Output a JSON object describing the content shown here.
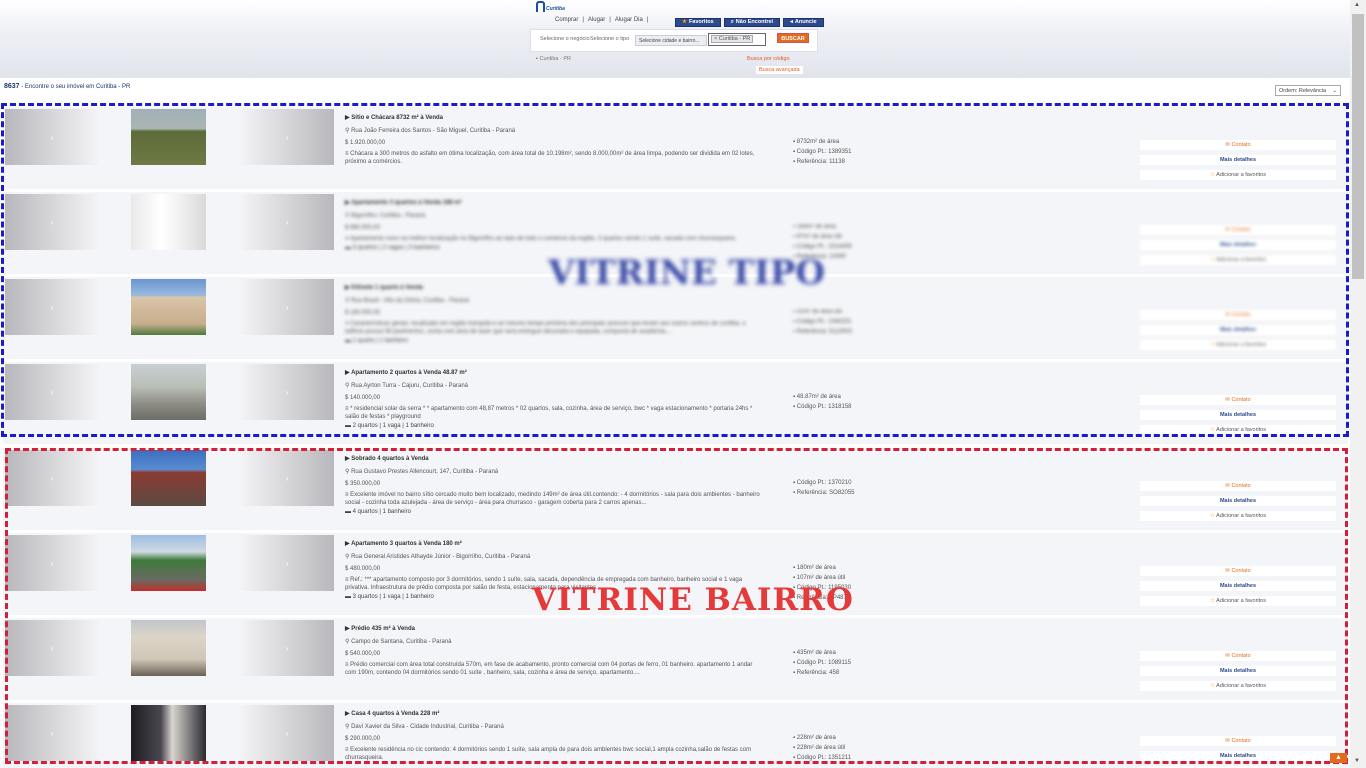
{
  "header": {
    "logo_text": "Curitiba",
    "nav": [
      "Comprar",
      "|",
      "Alugar",
      "|",
      "Alugar Dia",
      "|"
    ],
    "buttons": [
      {
        "label": "Favoritos",
        "icon": "star-icon"
      },
      {
        "label": "Não Encontrei",
        "icon": "search-icon"
      },
      {
        "label": "Anuncie",
        "icon": "megaphone-icon"
      }
    ]
  },
  "search": {
    "label1": "Selecione o negócio",
    "label2": "Selecione o tipo",
    "city_select": "Selecione cidade e bairro...",
    "location_tag": "× Curitiba - PR",
    "button": "BUSCAR",
    "location_line": "Curitiba - PR",
    "search_by_code": "Busca por código",
    "advanced_search": "Busca avançada"
  },
  "results": {
    "count": "8637",
    "text": " - Encontre o seu imóvel em Curitiba - PR",
    "order": "Ordem: Relevância"
  },
  "overlay": {
    "tipo_label": "VITRINE TIPO",
    "bairro_label": "VITRINE BAIRRO"
  },
  "listings": [
    {
      "title": "Sítio e Chácara 8732 m² à Venda",
      "address": "Rua João Ferreira dos Santos - São Miguel, Curitiba - Paraná",
      "price": "1.920.000,00",
      "desc": "Chácara a 300 metros do asfalto em ótima localização, com área total de 10.198m², sendo 8.000,00m² de área limpa, podendo ser dividida em 02 lotes, próximo a comércios.",
      "rooms": "",
      "specs": [
        "8732m² de área",
        "Código Pt.: 1389351",
        "Referência: 11138"
      ],
      "blur": false,
      "photo": "field"
    },
    {
      "title": "Apartamento 3 quartos à Venda 168 m²",
      "address": "Bigorrilho, Curitiba - Paraná",
      "price": "980.000,00",
      "desc": "Apartamento novo na melhor localização no Bigorrilho ao lado de todo o comércio da região, 3 quartos sendo 1 suíte, sacada com churrasqueira.",
      "rooms": "3 quartos | 2 vagas | 3 banheiros",
      "specs": [
        "168m² de área",
        "97m² de área útil",
        "Código Pt.: 1514409",
        "Referência: 10090"
      ],
      "blur": true,
      "photo": "interior"
    },
    {
      "title": "Kitinete 1 quarto à Venda",
      "address": "Rua Brasil - Alto da Glória, Curitiba - Paraná",
      "price": "180.000,00",
      "desc": "Características gerais: localizado em região tranquila e ao mesmo tempo próxima dos principais acessos que levam aos outros centros de curitiba. o edifício possui 08 pavimentos, conta com área de lazer que será entregue decorada e equipada, composta de academia....",
      "rooms": "1 quarto | 1 banheiro",
      "specs": [
        "31m² de área útil",
        "Código Pt.: 1340201",
        "Referência: 5113003"
      ],
      "blur": true,
      "photo": "building"
    },
    {
      "title": "Apartamento 2 quartos à Venda 48.87 m²",
      "address": "Rua Ayrton Turra - Cajuru, Curitiba - Paraná",
      "price": "140.000,00",
      "desc": "* residencial solar da serra * * apartamento com 48,87 metros * 02 quartos, sala, cozinha, área de serviço, bwc * vaga estacionamento * portaria 24hs * salão de festas * playground",
      "rooms": "2 quartos | 1 vaga | 1 banheiro",
      "specs": [
        "48.87m² de área",
        "Código Pt.: 1318158"
      ],
      "blur": false,
      "photo": "street"
    },
    {
      "title": "Sobrado 4 quartos à Venda",
      "address": "Rua Gustavo Prestes Allencourt, 147, Curitiba - Paraná",
      "price": "350.000,00",
      "desc": "Excelente imóvel no bairro sítio cercado muito bem localizado, medindo 149m² de área útil.contendo: - 4 dormitórios - sala para dois ambientes - banheiro social - cozinha toda azulejada - área de serviço - área para churrasco - garagem coberta para 2 carros apenas...",
      "rooms": "4 quartos | 1 banheiro",
      "specs": [
        "Código Pt.: 1370210",
        "Referência: SO82055"
      ],
      "blur": false,
      "photo": "house"
    },
    {
      "title": "Apartamento 3 quartos à Venda 180 m²",
      "address": "Rua General Aristides Athayde Júnior - Bigorrilho, Curitiba - Paraná",
      "price": "480.000,00",
      "desc": "Ref.: *** apartamento composto por 3 dormitórios, sendo 1 suíte, sala, sacada, dependência de empregada com banheiro, banheiro social e 1 vaga privativa. Infraestrutura de prédio composta por salão de festa, estacionamento para visitantes.",
      "rooms": "3 quartos | 1 vaga | 1 banheiro",
      "specs": [
        "180m² de área",
        "107m² de área útil",
        "Código Pt.: 1195030",
        "Referência: AP4873"
      ],
      "blur": false,
      "photo": "trees"
    },
    {
      "title": "Prédio 435 m² à Venda",
      "address": "Campo de Santana, Curitiba - Paraná",
      "price": "540.000,00",
      "desc": "Prédio comercial com área total construída 570m, em fase de acabamento, pronto comercial com 04 portas de ferro, 01 banheiro. apartamento 1 andar com 190m, contendo 04 dormitórios sendo 01 suíte , banheiro, sala, cozinha e área de serviço, apartamento....",
      "rooms": "",
      "specs": [
        "435m² de área",
        "Código Pt.: 1089115",
        "Referência: 458"
      ],
      "blur": false,
      "photo": "building2"
    },
    {
      "title": "Casa 4 quartos à Venda 228 m²",
      "address": "Davi Xavier da Silva - Cidade Industrial, Curitiba - Paraná",
      "price": "290.000,00",
      "desc": "Excelente residência no cic contendo: 4 dormitórios sendo 1 suíte, sala ampla de para dois ambientes bwc social,1 ampla cozinha,salão de festas com churrasqueira.",
      "rooms": "",
      "specs": [
        "228m² de área",
        "228m² de área útil",
        "Código Pt.: 1351211"
      ],
      "blur": false,
      "photo": "dark"
    }
  ],
  "actions": {
    "contact": "Contato",
    "details": "Mais detalhes",
    "favorite": "Adicionar a favoritos"
  }
}
